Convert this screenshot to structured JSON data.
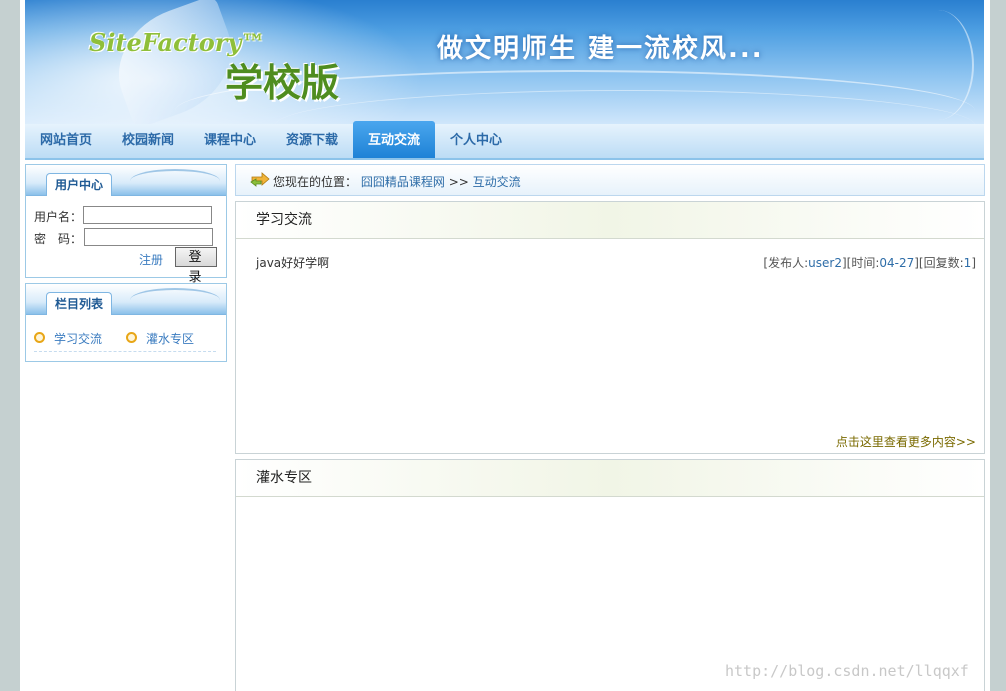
{
  "banner": {
    "logo_en": "SiteFactory™",
    "logo_zh": "学校版",
    "slogan": "做文明师生  建一流校风..."
  },
  "nav": {
    "items": [
      "网站首页",
      "校园新闻",
      "课程中心",
      "资源下载",
      "互动交流",
      "个人中心"
    ],
    "active": "互动交流"
  },
  "user_center": {
    "title": "用户中心",
    "username_label": "用户名：",
    "password_label": "密　码：",
    "register": "注册",
    "login": "登录"
  },
  "column_list": {
    "title": "栏目列表",
    "items": [
      "学习交流",
      "灌水专区"
    ]
  },
  "breadcrumb": {
    "prefix": "您现在的位置：",
    "site": "囧囧精品课程网",
    "sep": ">>",
    "current": "互动交流"
  },
  "study_panel": {
    "title": "学习交流",
    "post_title": "java好好学啊",
    "author_label": "[发布人:",
    "author": "user2",
    "time_label": "][时间:",
    "time": "04-27",
    "reply_label": "][回复数:",
    "reply_count": "1",
    "close": "]",
    "more": "点击这里查看更多内容>>"
  },
  "water_panel": {
    "title": "灌水专区"
  },
  "watermark": "http://blog.csdn.net/llqqxf",
  "colors": {
    "nav_active": "#1e82d6",
    "link": "#2e6da8",
    "border": "#9cc9e6"
  }
}
